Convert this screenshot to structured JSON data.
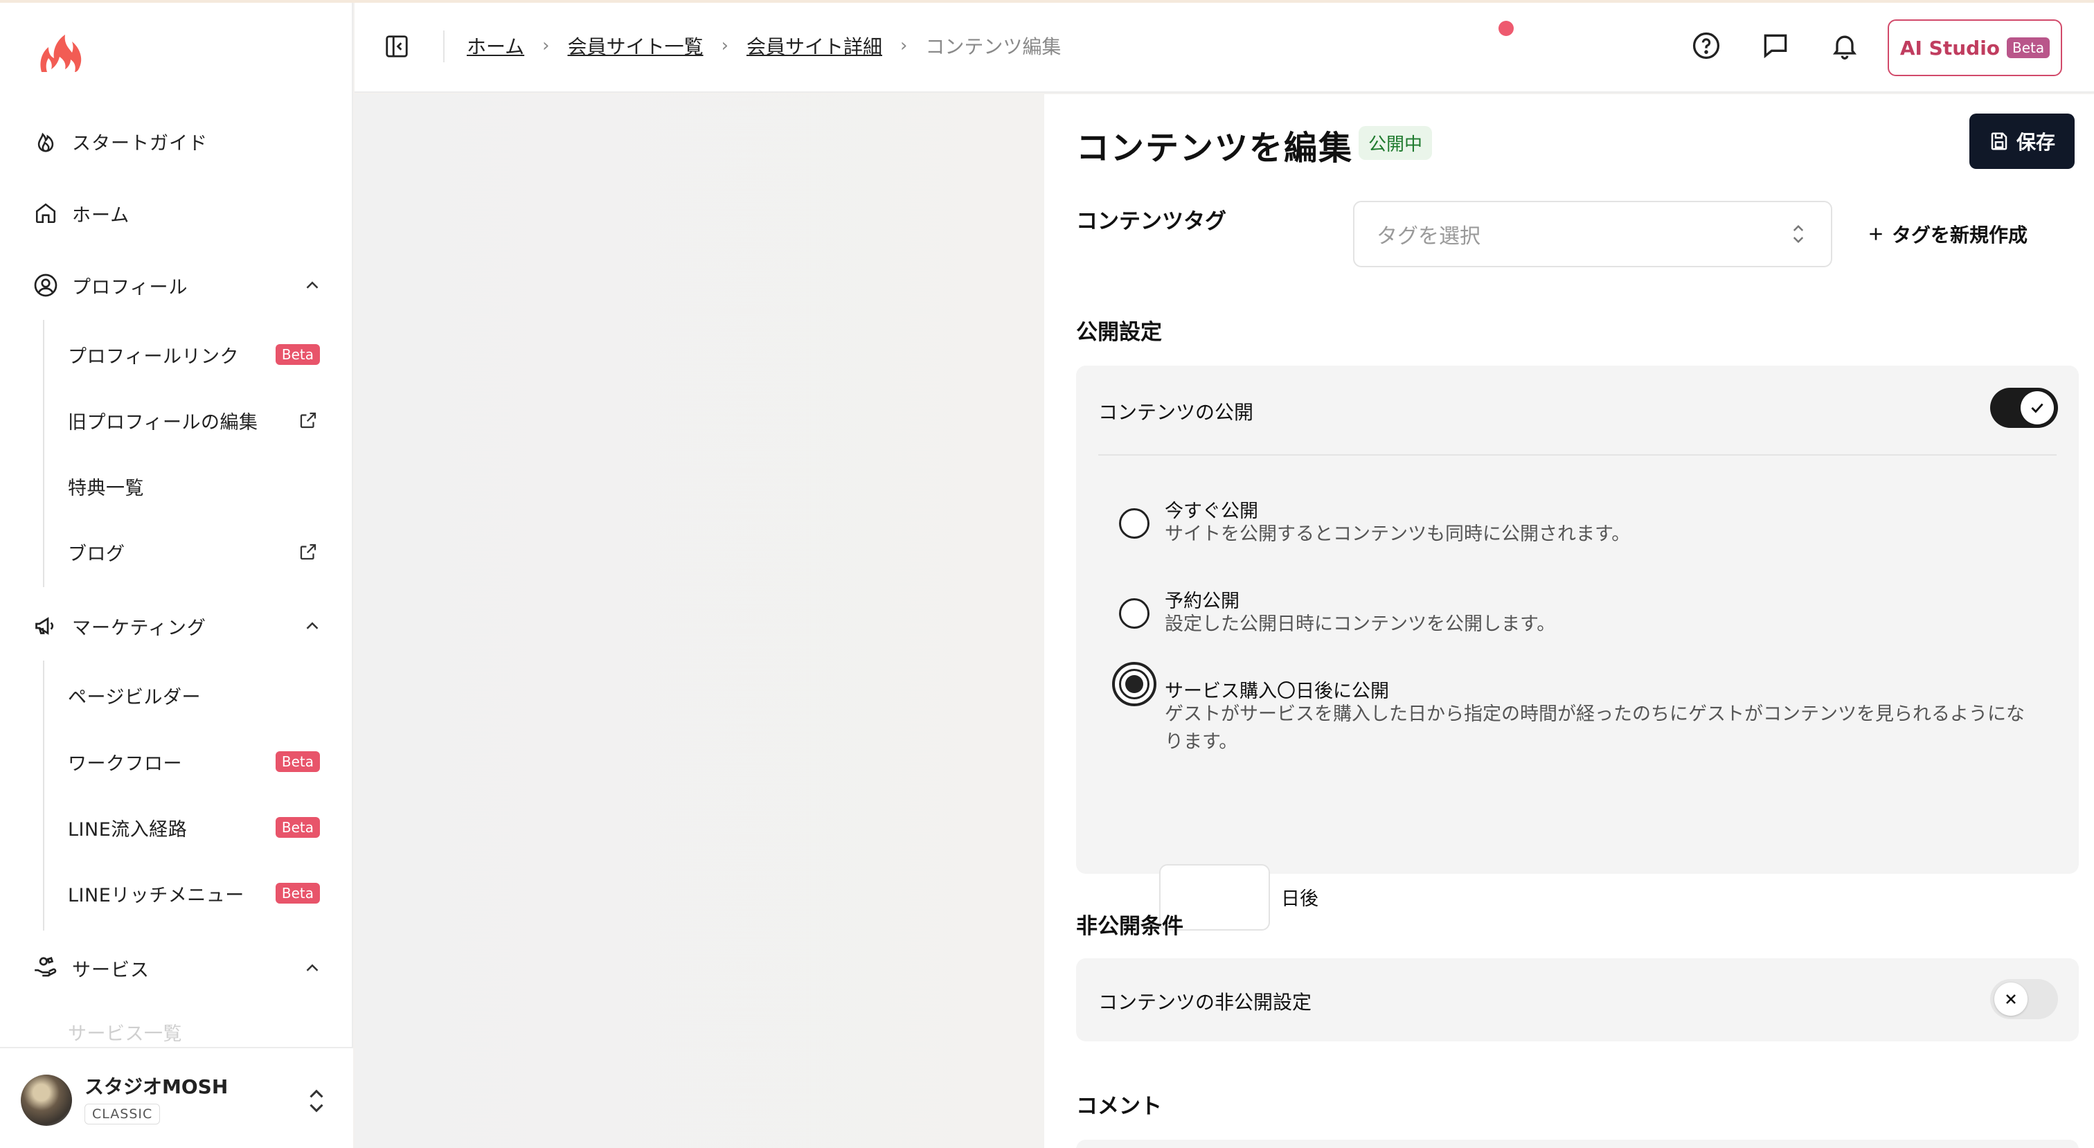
{
  "sidebar": {
    "logo": "brand-flame-logo",
    "items": [
      {
        "label": "スタートガイド",
        "icon": "flame-outline-icon"
      },
      {
        "label": "ホーム",
        "icon": "home-icon"
      },
      {
        "label": "プロフィール",
        "icon": "user-circle-icon",
        "expanded": true,
        "children": [
          {
            "label": "プロフィールリンク",
            "badge": "Beta"
          },
          {
            "label": "旧プロフィールの編集",
            "external": true
          },
          {
            "label": "特典一覧"
          },
          {
            "label": "ブログ",
            "external": true
          }
        ]
      },
      {
        "label": "マーケティング",
        "icon": "megaphone-icon",
        "expanded": true,
        "children": [
          {
            "label": "ページビルダー"
          },
          {
            "label": "ワークフロー",
            "badge": "Beta"
          },
          {
            "label": "LINE流入経路",
            "badge": "Beta"
          },
          {
            "label": "LINEリッチメニュー",
            "badge": "Beta"
          }
        ]
      },
      {
        "label": "サービス",
        "icon": "service-hand-icon",
        "expanded": true,
        "children": [
          {
            "label": "サービス一覧"
          }
        ]
      }
    ],
    "account": {
      "name": "スタジオMOSH",
      "plan": "CLASSIC"
    }
  },
  "header": {
    "breadcrumb": [
      "ホーム",
      "会員サイト一覧",
      "会員サイト詳細"
    ],
    "current": "コンテンツ編集",
    "ai_studio": {
      "label": "AI Studio",
      "badge": "Beta"
    }
  },
  "editor": {
    "title": "コンテンツを編集",
    "status": "公開中",
    "save_label": "保存",
    "tag_label": "コンテンツタグ",
    "tag_placeholder": "タグを選択",
    "new_tag_label": "タグを新規作成",
    "publish_section": "公開設定",
    "publish_toggle_label": "コンテンツの公開",
    "publish_enabled": true,
    "options": [
      {
        "title": "今すぐ公開",
        "desc": "サイトを公開するとコンテンツも同時に公開されます。",
        "selected": false
      },
      {
        "title": "予約公開",
        "desc": "設定した公開日時にコンテンツを公開します。",
        "selected": false
      },
      {
        "title": "サービス購入〇日後に公開",
        "desc": "ゲストがサービスを購入した日から指定の時間が経ったのちにゲストがコンテンツを見られるようになります。",
        "selected": true
      }
    ],
    "days_value": "",
    "days_suffix": "日後",
    "unpublish_section": "非公開条件",
    "unpublish_toggle_label": "コンテンツの非公開設定",
    "unpublish_enabled": false,
    "comment_section": "コメント"
  },
  "colors": {
    "accent": "#e8546a",
    "primary_dark": "#101828",
    "status_green": "#1f7a2e",
    "ai_pink": "#c03d5f"
  }
}
